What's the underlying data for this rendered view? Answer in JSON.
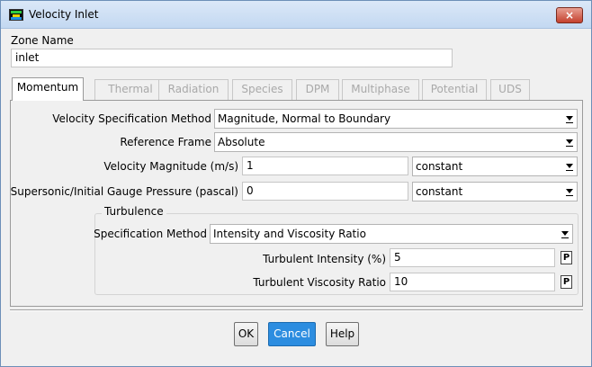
{
  "window": {
    "title": "Velocity Inlet",
    "close_label": "×"
  },
  "zone": {
    "label": "Zone Name",
    "value": "inlet"
  },
  "tabs": [
    {
      "label": "Momentum",
      "active": true
    },
    {
      "label": "Thermal",
      "active": false
    },
    {
      "label": "Radiation",
      "active": false
    },
    {
      "label": "Species",
      "active": false
    },
    {
      "label": "DPM",
      "active": false
    },
    {
      "label": "Multiphase",
      "active": false
    },
    {
      "label": "Potential",
      "active": false
    },
    {
      "label": "UDS",
      "active": false
    }
  ],
  "momentum": {
    "velocity_spec": {
      "label": "Velocity Specification Method",
      "value": "Magnitude, Normal to Boundary"
    },
    "reference_frame": {
      "label": "Reference Frame",
      "value": "Absolute"
    },
    "velocity_magnitude": {
      "label": "Velocity Magnitude (m/s)",
      "value": "1",
      "profile": "constant"
    },
    "gauge_pressure": {
      "label": "Supersonic/Initial Gauge Pressure (pascal)",
      "value": "0",
      "profile": "constant"
    }
  },
  "turbulence": {
    "group_label": "Turbulence",
    "spec_method": {
      "label": "Specification Method",
      "value": "Intensity and Viscosity Ratio"
    },
    "intensity": {
      "label": "Turbulent Intensity (%)",
      "value": "5",
      "param_label": "P"
    },
    "viscosity_ratio": {
      "label": "Turbulent Viscosity Ratio",
      "value": "10",
      "param_label": "P"
    }
  },
  "buttons": {
    "ok": "OK",
    "cancel": "Cancel",
    "help": "Help"
  },
  "icons": {
    "app": "fluent-app-icon",
    "close": "close-icon",
    "dropdown": "chevron-down-icon"
  },
  "colors": {
    "primary_button": "#2c8de0",
    "close_button": "#c4402d"
  }
}
